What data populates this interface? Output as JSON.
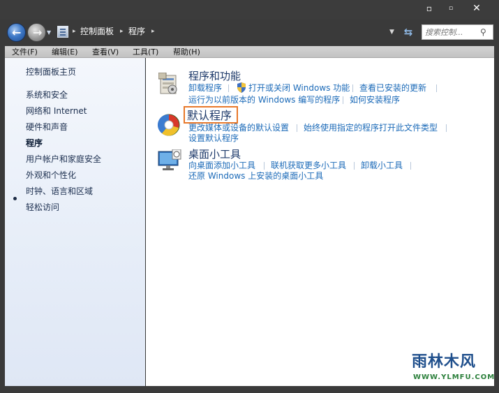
{
  "window": {
    "controls": {
      "minimize": "▫",
      "maximize": "▫",
      "close": "✕"
    }
  },
  "nav": {
    "breadcrumbs": [
      "控制面板",
      "程序"
    ],
    "search": {
      "placeholder": "搜索控制..."
    }
  },
  "menu": {
    "items": [
      "文件(F)",
      "编辑(E)",
      "查看(V)",
      "工具(T)",
      "帮助(H)"
    ]
  },
  "sidebar": {
    "items": [
      {
        "label": "控制面板主页"
      },
      {
        "label": "系统和安全"
      },
      {
        "label": "网络和 Internet"
      },
      {
        "label": "硬件和声音"
      },
      {
        "label": "程序",
        "active": true
      },
      {
        "label": "用户帐户和家庭安全"
      },
      {
        "label": "外观和个性化"
      },
      {
        "label": "时钟、语言和区域"
      },
      {
        "label": "轻松访问"
      }
    ]
  },
  "main": {
    "categories": [
      {
        "title": "程序和功能",
        "icon": "programs-features-icon",
        "links": [
          "卸载程序",
          "打开或关闭 Windows 功能",
          "查看已安装的更新",
          "运行为以前版本的 Windows 编写的程序",
          "如何安装程序"
        ]
      },
      {
        "title": "默认程序",
        "icon": "default-programs-icon",
        "links": [
          "更改媒体或设备的默认设置",
          "始终使用指定的程序打开此文件类型",
          "设置默认程序"
        ]
      },
      {
        "title": "桌面小工具",
        "icon": "desktop-gadgets-icon",
        "links": [
          "向桌面添加小工具",
          "联机获取更多小工具",
          "卸载小工具",
          "还原 Windows 上安装的桌面小工具"
        ]
      }
    ]
  },
  "watermark": {
    "main": "雨林木风",
    "sub": "WWW.YLMFU.COM"
  },
  "colors": {
    "link": "#1b6ab8",
    "title": "#1e3a6a",
    "highlight": "#e8782a"
  }
}
